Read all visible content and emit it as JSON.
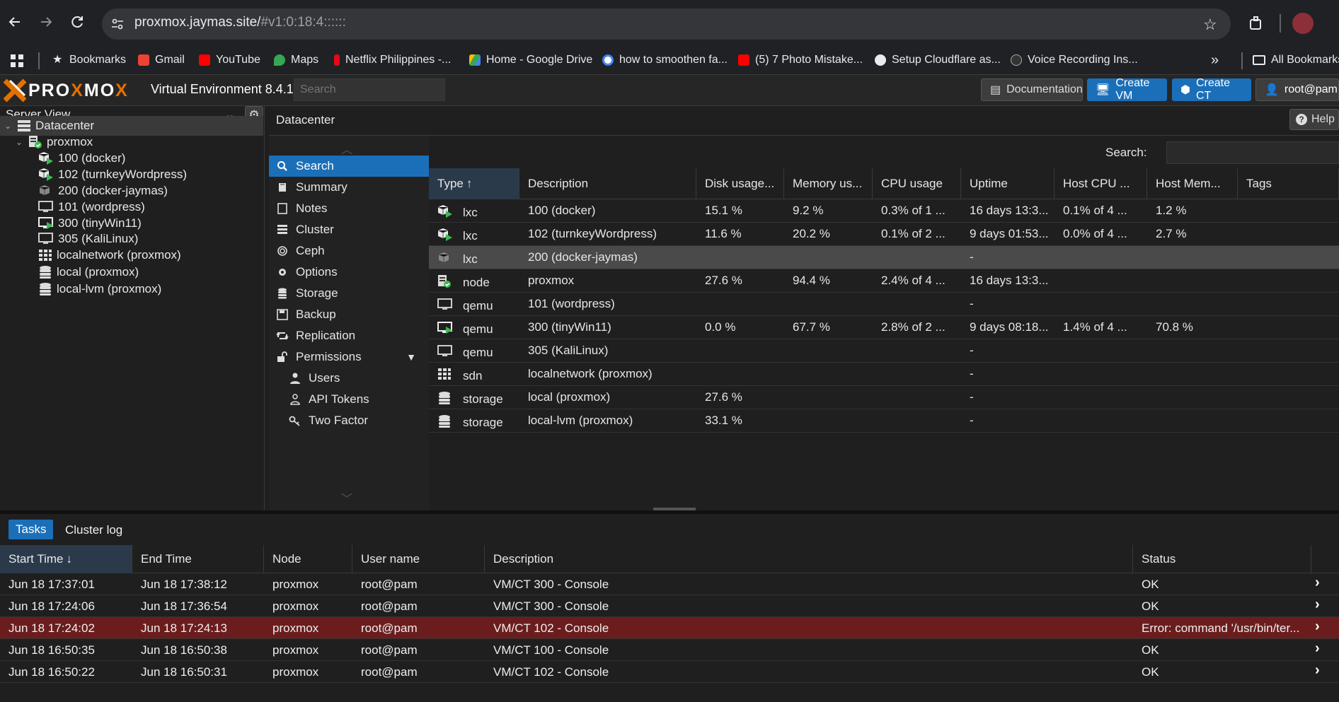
{
  "browser": {
    "url_host": "proxmox.jaymas.site/",
    "url_path": "#v1:0:18:4::::::",
    "bookmarks": [
      {
        "label": "Bookmarks",
        "color": "#e8eaed"
      },
      {
        "label": "Gmail",
        "color": "#ea4335"
      },
      {
        "label": "YouTube",
        "color": "#ff0000"
      },
      {
        "label": "Maps",
        "color": "#34a853"
      },
      {
        "label": "Netflix Philippines -...",
        "color": "#e50914"
      },
      {
        "label": "Home - Google Drive",
        "color": "#fbbc04"
      },
      {
        "label": "how to smoothen fa...",
        "color": "#4285f4"
      },
      {
        "label": "(5) 7 Photo Mistake...",
        "color": "#ff0000"
      },
      {
        "label": "Setup Cloudflare as...",
        "color": "#e8eaed"
      },
      {
        "label": "Voice Recording Ins...",
        "color": "#e8eaed"
      }
    ],
    "all_bookmarks": "All Bookmarks"
  },
  "header": {
    "product": "Virtual Environment 8.4.1",
    "search_placeholder": "Search",
    "documentation": "Documentation",
    "create_vm": "Create VM",
    "create_ct": "Create CT",
    "user": "root@pam"
  },
  "left": {
    "view": "Server View",
    "tree": [
      {
        "label": "Datacenter",
        "icon": "datacenter-icon",
        "level": 0
      },
      {
        "label": "proxmox",
        "icon": "node-icon",
        "level": 1
      },
      {
        "label": "100 (docker)",
        "icon": "lxc-running-icon",
        "level": 2
      },
      {
        "label": "102 (turnkeyWordpress)",
        "icon": "lxc-running-icon",
        "level": 2
      },
      {
        "label": "200 (docker-jaymas)",
        "icon": "lxc-stopped-icon",
        "level": 2
      },
      {
        "label": "101 (wordpress)",
        "icon": "vm-stopped-icon",
        "level": 2
      },
      {
        "label": "300 (tinyWin11)",
        "icon": "vm-running-icon",
        "level": 2
      },
      {
        "label": "305 (KaliLinux)",
        "icon": "vm-stopped-icon",
        "level": 2
      },
      {
        "label": "localnetwork (proxmox)",
        "icon": "sdn-icon",
        "level": 2
      },
      {
        "label": "local (proxmox)",
        "icon": "storage-icon",
        "level": 2
      },
      {
        "label": "local-lvm (proxmox)",
        "icon": "storage-icon",
        "level": 2
      }
    ]
  },
  "content": {
    "title": "Datacenter",
    "help": "Help",
    "search_label": "Search:"
  },
  "nav": [
    {
      "label": "Search",
      "icon": "search-icon",
      "sub": false
    },
    {
      "label": "Summary",
      "icon": "book-icon",
      "sub": false
    },
    {
      "label": "Notes",
      "icon": "notes-icon",
      "sub": false
    },
    {
      "label": "Cluster",
      "icon": "server-icon",
      "sub": false
    },
    {
      "label": "Ceph",
      "icon": "ceph-icon",
      "sub": false
    },
    {
      "label": "Options",
      "icon": "gear-icon",
      "sub": false
    },
    {
      "label": "Storage",
      "icon": "database-icon",
      "sub": false
    },
    {
      "label": "Backup",
      "icon": "floppy-icon",
      "sub": false
    },
    {
      "label": "Replication",
      "icon": "retweet-icon",
      "sub": false
    },
    {
      "label": "Permissions",
      "icon": "unlock-icon",
      "sub": false
    },
    {
      "label": "Users",
      "icon": "user-icon",
      "sub": true
    },
    {
      "label": "API Tokens",
      "icon": "user-outline-icon",
      "sub": true
    },
    {
      "label": "Two Factor",
      "icon": "key-icon",
      "sub": true
    }
  ],
  "grid": {
    "columns": [
      "Type",
      "Description",
      "Disk usage...",
      "Memory us...",
      "CPU usage",
      "Uptime",
      "Host CPU ...",
      "Host Mem...",
      "Tags"
    ],
    "rows": [
      {
        "icon": "lxc-running-icon",
        "type": "lxc",
        "desc": "100 (docker)",
        "disk": "15.1 %",
        "mem": "9.2 %",
        "cpu": "0.3% of 1 ...",
        "uptime": "16 days 13:3...",
        "hcpu": "0.1% of 4 ...",
        "hmem": "1.2 %"
      },
      {
        "icon": "lxc-running-icon",
        "type": "lxc",
        "desc": "102 (turnkeyWordpress)",
        "disk": "11.6 %",
        "mem": "20.2 %",
        "cpu": "0.1% of 2 ...",
        "uptime": "9 days 01:53...",
        "hcpu": "0.0% of 4 ...",
        "hmem": "2.7 %"
      },
      {
        "icon": "lxc-stopped-icon",
        "type": "lxc",
        "desc": "200 (docker-jaymas)",
        "disk": "",
        "mem": "",
        "cpu": "",
        "uptime": "-",
        "hcpu": "",
        "hmem": ""
      },
      {
        "icon": "node-icon",
        "type": "node",
        "desc": "proxmox",
        "disk": "27.6 %",
        "mem": "94.4 %",
        "cpu": "2.4% of 4 ...",
        "uptime": "16 days 13:3...",
        "hcpu": "",
        "hmem": ""
      },
      {
        "icon": "vm-stopped-icon",
        "type": "qemu",
        "desc": "101 (wordpress)",
        "disk": "",
        "mem": "",
        "cpu": "",
        "uptime": "-",
        "hcpu": "",
        "hmem": ""
      },
      {
        "icon": "vm-running-icon",
        "type": "qemu",
        "desc": "300 (tinyWin11)",
        "disk": "0.0 %",
        "mem": "67.7 %",
        "cpu": "2.8% of 2 ...",
        "uptime": "9 days 08:18...",
        "hcpu": "1.4% of 4 ...",
        "hmem": "70.8 %"
      },
      {
        "icon": "vm-stopped-icon",
        "type": "qemu",
        "desc": "305 (KaliLinux)",
        "disk": "",
        "mem": "",
        "cpu": "",
        "uptime": "-",
        "hcpu": "",
        "hmem": ""
      },
      {
        "icon": "sdn-icon",
        "type": "sdn",
        "desc": "localnetwork (proxmox)",
        "disk": "",
        "mem": "",
        "cpu": "",
        "uptime": "-",
        "hcpu": "",
        "hmem": ""
      },
      {
        "icon": "storage-icon",
        "type": "storage",
        "desc": "local (proxmox)",
        "disk": "27.6 %",
        "mem": "",
        "cpu": "",
        "uptime": "-",
        "hcpu": "",
        "hmem": ""
      },
      {
        "icon": "storage-icon",
        "type": "storage",
        "desc": "local-lvm (proxmox)",
        "disk": "33.1 %",
        "mem": "",
        "cpu": "",
        "uptime": "-",
        "hcpu": "",
        "hmem": ""
      }
    ]
  },
  "tasks": {
    "tabs": [
      "Tasks",
      "Cluster log"
    ],
    "columns": [
      "Start Time",
      "End Time",
      "Node",
      "User name",
      "Description",
      "Status"
    ],
    "rows": [
      {
        "start": "Jun 18 17:37:01",
        "end": "Jun 18 17:38:12",
        "node": "proxmox",
        "user": "root@pam",
        "desc": "VM/CT 300 - Console",
        "status": "OK",
        "error": false
      },
      {
        "start": "Jun 18 17:24:06",
        "end": "Jun 18 17:36:54",
        "node": "proxmox",
        "user": "root@pam",
        "desc": "VM/CT 300 - Console",
        "status": "OK",
        "error": false
      },
      {
        "start": "Jun 18 17:24:02",
        "end": "Jun 18 17:24:13",
        "node": "proxmox",
        "user": "root@pam",
        "desc": "VM/CT 102 - Console",
        "status": "Error: command '/usr/bin/ter...",
        "error": true
      },
      {
        "start": "Jun 18 16:50:35",
        "end": "Jun 18 16:50:38",
        "node": "proxmox",
        "user": "root@pam",
        "desc": "VM/CT 100 - Console",
        "status": "OK",
        "error": false
      },
      {
        "start": "Jun 18 16:50:22",
        "end": "Jun 18 16:50:31",
        "node": "proxmox",
        "user": "root@pam",
        "desc": "VM/CT 102 - Console",
        "status": "OK",
        "error": false
      }
    ]
  },
  "colors": {
    "accent": "#1b6fb8",
    "error_row": "#6b1d1d",
    "selected_row": "#4a4a4a",
    "running": "#3fb950"
  }
}
